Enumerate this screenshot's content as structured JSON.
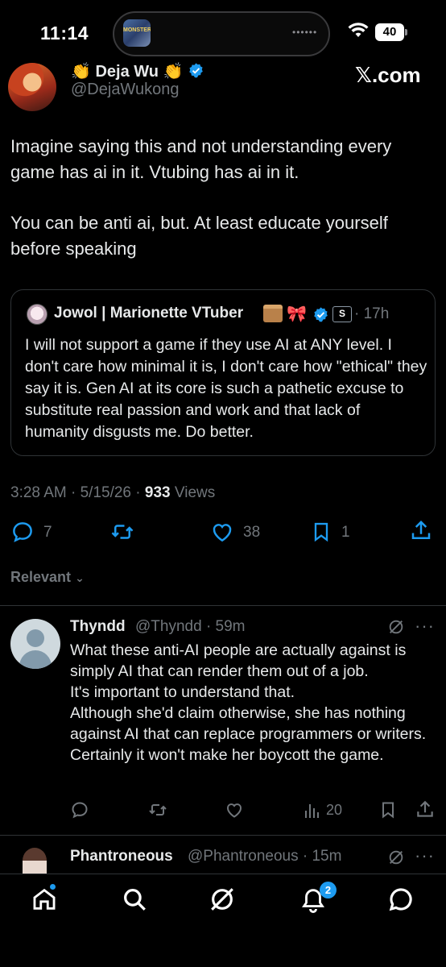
{
  "status_bar": {
    "time": "11:14",
    "battery": "40",
    "app_icon_text": "MONSTER"
  },
  "header": {
    "site": "𝕏.com"
  },
  "tweet": {
    "display_name": "Deja Wu",
    "handle": "@DejaWukong",
    "paragraphs": [
      "Imagine saying this and not understanding every game has ai in it. Vtubing has ai in it.",
      "You can be anti ai, but. At least educate yourself before speaking"
    ],
    "time": "3:28 AM",
    "date": "5/15/26",
    "views_count": "933",
    "views_label": "Views",
    "replies": "7",
    "likes": "38",
    "bookmarks": "1"
  },
  "quote": {
    "display_name": "Jowol | Marionette VTuber",
    "sub_badge": "S",
    "age": "· 17h",
    "text": "I will not support a game if they use AI at ANY level. I don't care how minimal it is, I don't care how \"ethical\" they say it is. Gen AI at its core is such a pathetic excuse to substitute real passion and work and that lack of humanity disgusts me. Do better."
  },
  "replies_sort": {
    "label": "Relevant"
  },
  "reply1": {
    "display_name": "Thyndd",
    "handle_time": "@Thyndd · 59m",
    "text_lines": [
      "What these anti-AI people are actually against is simply AI that can render them out of a job.",
      "It's important to understand that.",
      "Although she'd claim otherwise, she has nothing against AI that can replace programmers or writers. Certainly it won't make her boycott the game."
    ],
    "views": "20"
  },
  "reply2": {
    "display_name": "Phantroneous",
    "handle_time": "@Phantroneous · 15m"
  },
  "bottom_nav": {
    "notifications_badge": "2"
  },
  "colors": {
    "background": "#000000",
    "text": "#e7e9ea",
    "muted": "#71767b",
    "accent": "#1d9bf0",
    "border": "#2f3336"
  }
}
